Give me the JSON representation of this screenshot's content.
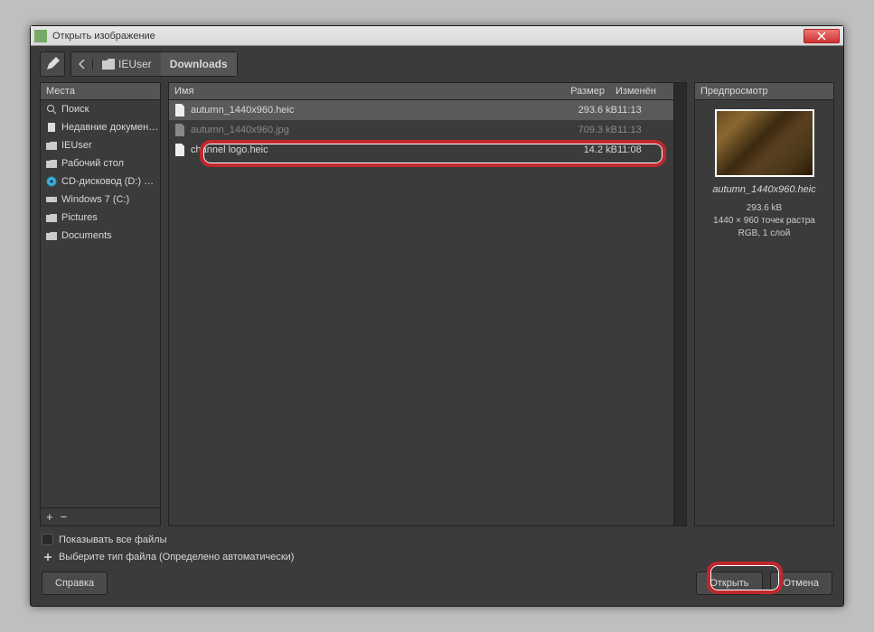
{
  "titlebar": {
    "title": "Открыть изображение"
  },
  "breadcrumb": {
    "items": [
      "IEUser",
      "Downloads"
    ]
  },
  "places": {
    "header": "Места",
    "items": [
      {
        "icon": "search",
        "label": "Поиск"
      },
      {
        "icon": "doc",
        "label": "Недавние докумен…"
      },
      {
        "icon": "folder",
        "label": "IEUser"
      },
      {
        "icon": "folder",
        "label": "Рабочий стол"
      },
      {
        "icon": "disc",
        "label": "CD-дисковод (D:) …"
      },
      {
        "icon": "drive",
        "label": "Windows 7  (C:)"
      },
      {
        "icon": "folder",
        "label": "Pictures"
      },
      {
        "icon": "folder",
        "label": "Documents"
      }
    ]
  },
  "filelist": {
    "headers": {
      "name": "Имя",
      "size": "Размер",
      "modified": "Изменён"
    },
    "rows": [
      {
        "name": "autumn_1440x960.heic",
        "size": "293.6 kB",
        "modified": "11:13",
        "selected": true
      },
      {
        "name": "autumn_1440x960.jpg",
        "size": "709.3 kB",
        "modified": "11:13",
        "obscured": true
      },
      {
        "name": "channel logo.heic",
        "size": "14.2 kB",
        "modified": "11:08"
      }
    ]
  },
  "preview": {
    "header": "Предпросмотр",
    "filename": "autumn_1440x960.heic",
    "info_size": "293.6 kB",
    "info_dims": "1440 × 960 точек растра",
    "info_mode": "RGB, 1 слой"
  },
  "bottom": {
    "show_all": "Показывать все файлы",
    "filetype": "Выберите тип файла (Определено автоматически)",
    "help": "Справка",
    "open": "Открыть",
    "cancel": "Отмена"
  }
}
